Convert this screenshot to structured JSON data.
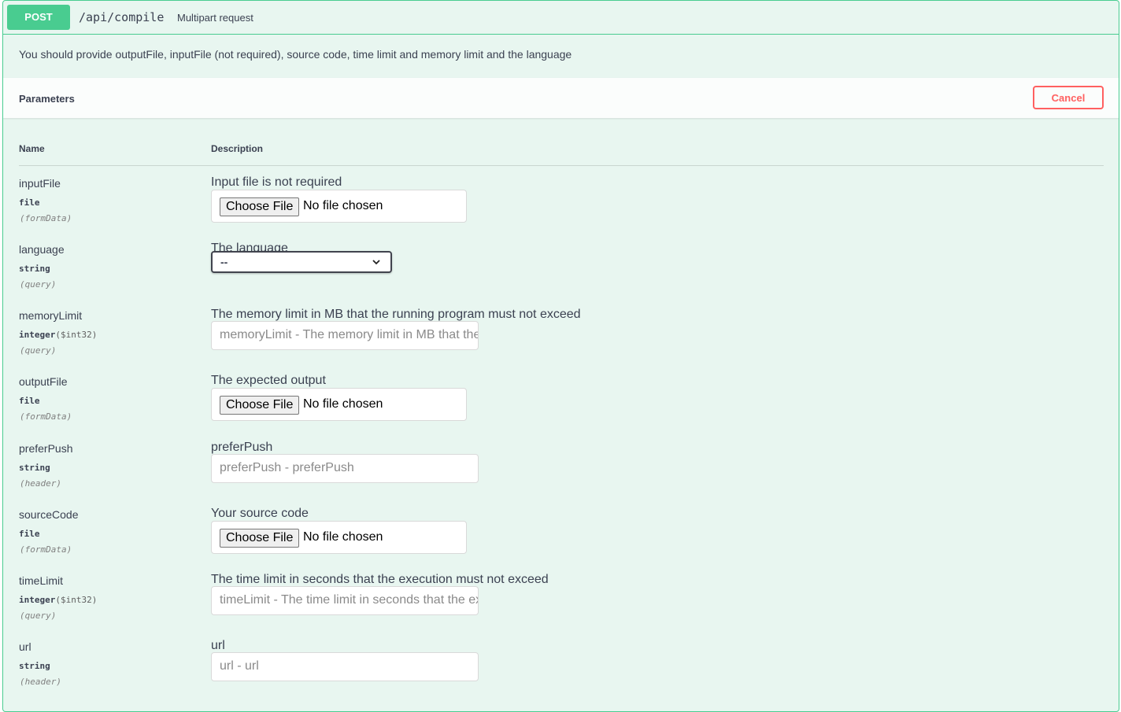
{
  "operation": {
    "method": "POST",
    "path": "/api/compile",
    "summary": "Multipart request",
    "description": "You should provide outputFile, inputFile (not required), source code, time limit and memory limit and the language"
  },
  "parameters_section": {
    "title": "Parameters",
    "cancel_label": "Cancel",
    "col_name": "Name",
    "col_description": "Description"
  },
  "file_input": {
    "button_label": "Choose File",
    "status": "No file chosen"
  },
  "params": [
    {
      "name": "inputFile",
      "type": "file",
      "format": "",
      "in": "(formData)",
      "description": "Input file is not required"
    },
    {
      "name": "language",
      "type": "string",
      "format": "",
      "in": "(query)",
      "description": "The language",
      "selected": "--"
    },
    {
      "name": "memoryLimit",
      "type": "integer",
      "format": "($int32)",
      "in": "(query)",
      "description": "The memory limit in MB that the running program must not exceed",
      "placeholder": "memoryLimit - The memory limit in MB that the running program must not exceed"
    },
    {
      "name": "outputFile",
      "type": "file",
      "format": "",
      "in": "(formData)",
      "description": "The expected output"
    },
    {
      "name": "preferPush",
      "type": "string",
      "format": "",
      "in": "(header)",
      "description": "preferPush",
      "placeholder": "preferPush - preferPush"
    },
    {
      "name": "sourceCode",
      "type": "file",
      "format": "",
      "in": "(formData)",
      "description": "Your source code"
    },
    {
      "name": "timeLimit",
      "type": "integer",
      "format": "($int32)",
      "in": "(query)",
      "description": "The time limit in seconds that the execution must not exceed",
      "placeholder": "timeLimit - The time limit in seconds that the execution must not exceed"
    },
    {
      "name": "url",
      "type": "string",
      "format": "",
      "in": "(header)",
      "description": "url",
      "placeholder": "url - url"
    }
  ],
  "colors": {
    "accent": "#49cc90",
    "background": "#e8f6f0",
    "cancel": "#ff6060",
    "text": "#3b4151"
  }
}
